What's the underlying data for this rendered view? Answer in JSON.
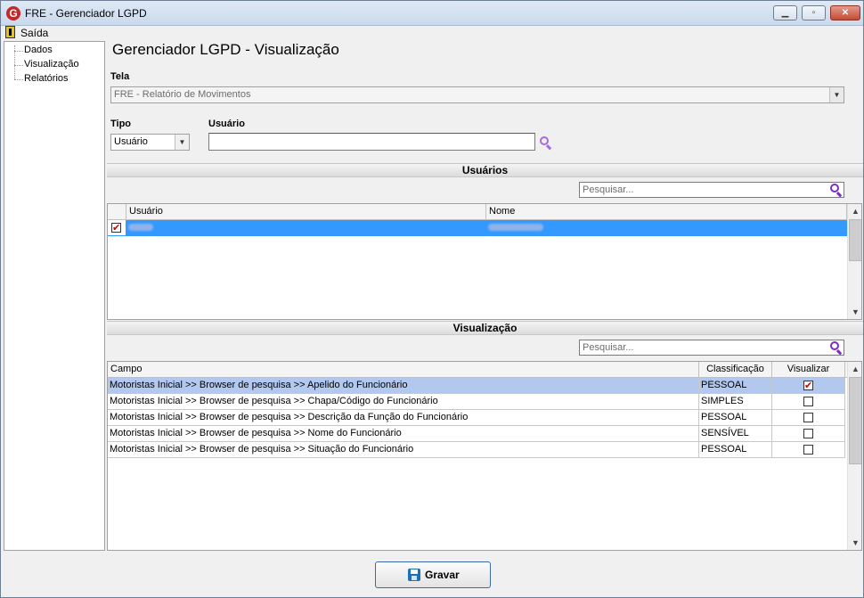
{
  "window": {
    "title": "FRE - Gerenciador LGPD",
    "minimize": "▁",
    "maximize": "▫",
    "close": "✕"
  },
  "menu": {
    "exit": "Saída"
  },
  "tree": {
    "items": [
      "Dados",
      "Visualização",
      "Relatórios"
    ]
  },
  "page": {
    "title": "Gerenciador LGPD - Visualização"
  },
  "form": {
    "tela_label": "Tela",
    "tela_value": "FRE - Relatório de Movimentos",
    "tipo_label": "Tipo",
    "tipo_value": "Usuário",
    "usuario_label": "Usuário",
    "usuario_value": ""
  },
  "usuarios": {
    "title": "Usuários",
    "search_placeholder": "Pesquisar...",
    "columns": [
      "Usuário",
      "Nome"
    ],
    "rows": [
      {
        "checked": true,
        "usuario": "",
        "nome": "",
        "selected": true
      }
    ]
  },
  "visualizacao": {
    "title": "Visualização",
    "search_placeholder": "Pesquisar...",
    "columns": [
      "Campo",
      "Classificação",
      "Visualizar"
    ],
    "rows": [
      {
        "campo": "Motoristas Inicial >> Browser de pesquisa >> Apelido do Funcionário",
        "classificacao": "PESSOAL",
        "visualizar": true,
        "selected": true
      },
      {
        "campo": "Motoristas Inicial >> Browser de pesquisa >> Chapa/Código do Funcionário",
        "classificacao": "SIMPLES",
        "visualizar": false,
        "selected": false
      },
      {
        "campo": "Motoristas Inicial >> Browser de pesquisa >> Descrição da Função do Funcionário",
        "classificacao": "PESSOAL",
        "visualizar": false,
        "selected": false
      },
      {
        "campo": "Motoristas Inicial >> Browser de pesquisa >> Nome do Funcionário",
        "classificacao": "SENSÍVEL",
        "visualizar": false,
        "selected": false
      },
      {
        "campo": "Motoristas Inicial >> Browser de pesquisa >> Situação do Funcionário",
        "classificacao": "PESSOAL",
        "visualizar": false,
        "selected": false
      }
    ]
  },
  "actions": {
    "save_label": "Gravar"
  },
  "colors": {
    "selection": "#3399ff",
    "row_highlight": "#b3c8ef",
    "search_icon": "#7b2cc4"
  }
}
